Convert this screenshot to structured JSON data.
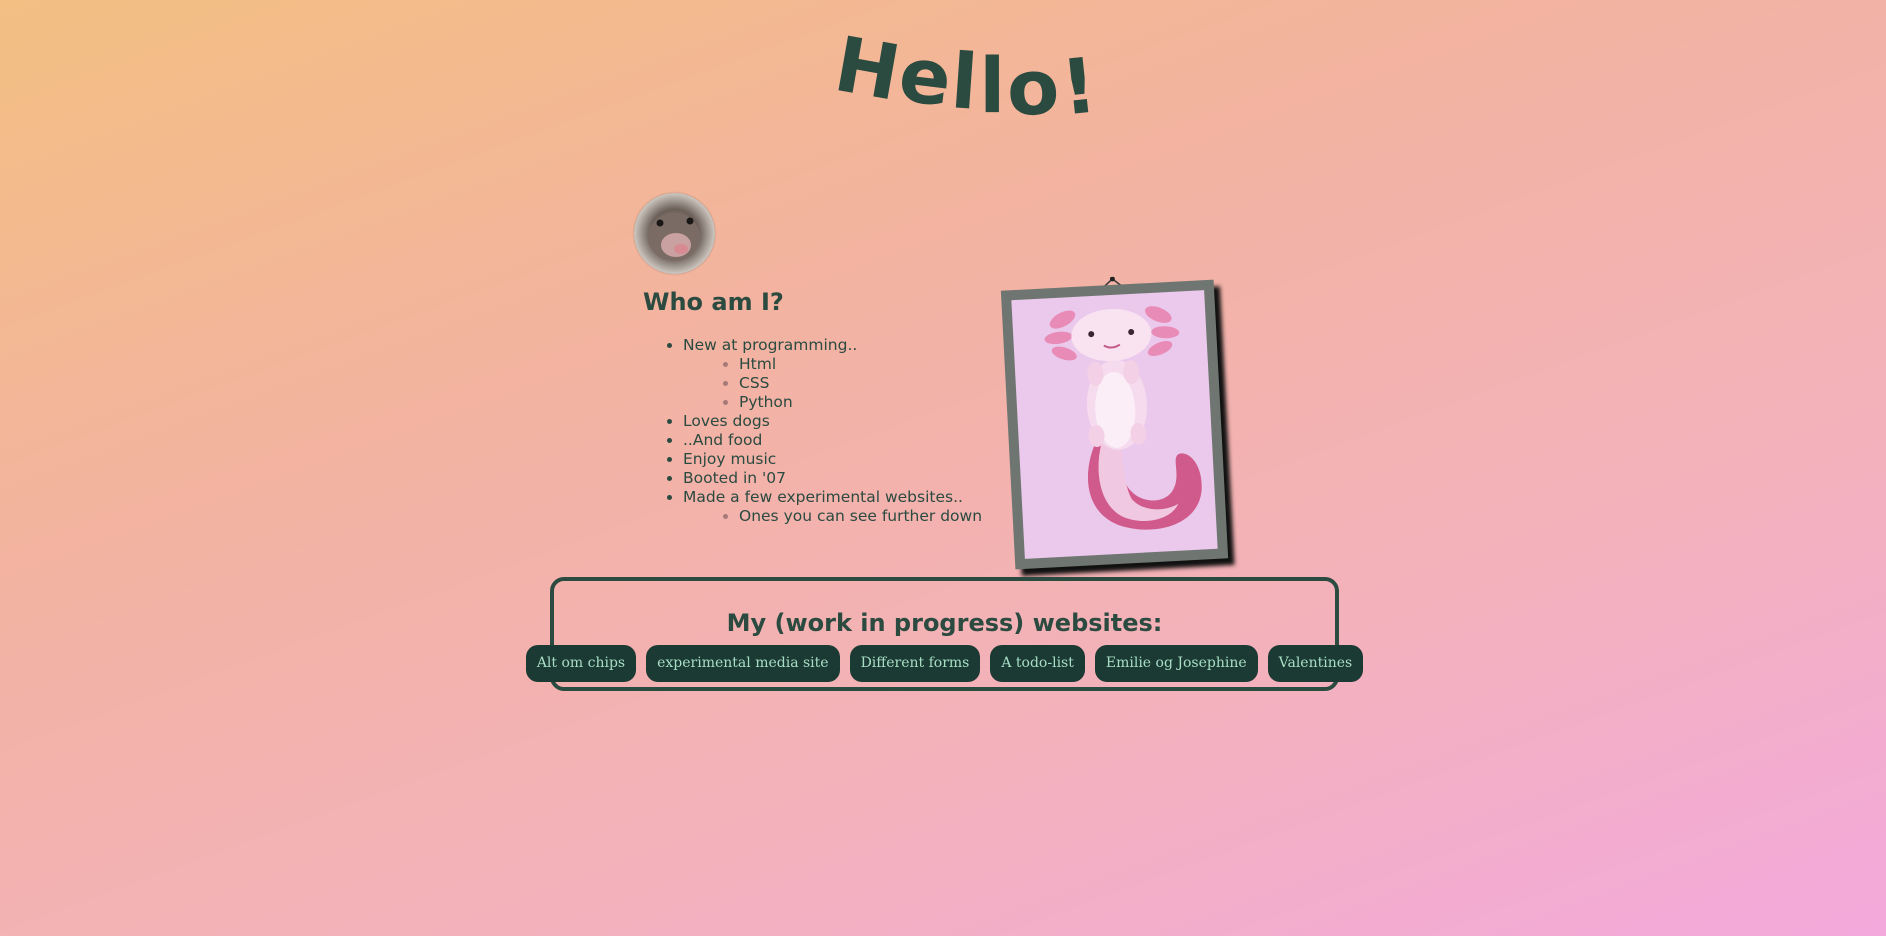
{
  "header": {
    "title_letters": [
      "H",
      "e",
      "l",
      "l",
      "o",
      "!"
    ]
  },
  "profile": {
    "avatar_alt": "ferret"
  },
  "intro": {
    "heading": "Who am I?",
    "items": [
      {
        "text": "New at programming..",
        "sub": [
          "Html",
          "CSS",
          "Python"
        ]
      },
      {
        "text": "Loves dogs"
      },
      {
        "text": "..And food"
      },
      {
        "text": "Enjoy music"
      },
      {
        "text": "Booted in '07"
      },
      {
        "text": "Made a few experimental websites..",
        "sub": [
          "Ones you can see further down"
        ]
      }
    ]
  },
  "framed_picture": {
    "subject": "axolotl"
  },
  "projects": {
    "heading": "My (work in progress) websites:",
    "links": [
      "Alt om chips",
      "experimental media site",
      "Different forms",
      "A todo-list",
      "Emilie og Josephine",
      "Valentines"
    ]
  },
  "colors": {
    "text": "#2b4a40",
    "button_bg": "#1b3a33",
    "button_text": "#a8dec5",
    "frame": "#6f7671",
    "frame_bg": "#ebc9ec"
  }
}
